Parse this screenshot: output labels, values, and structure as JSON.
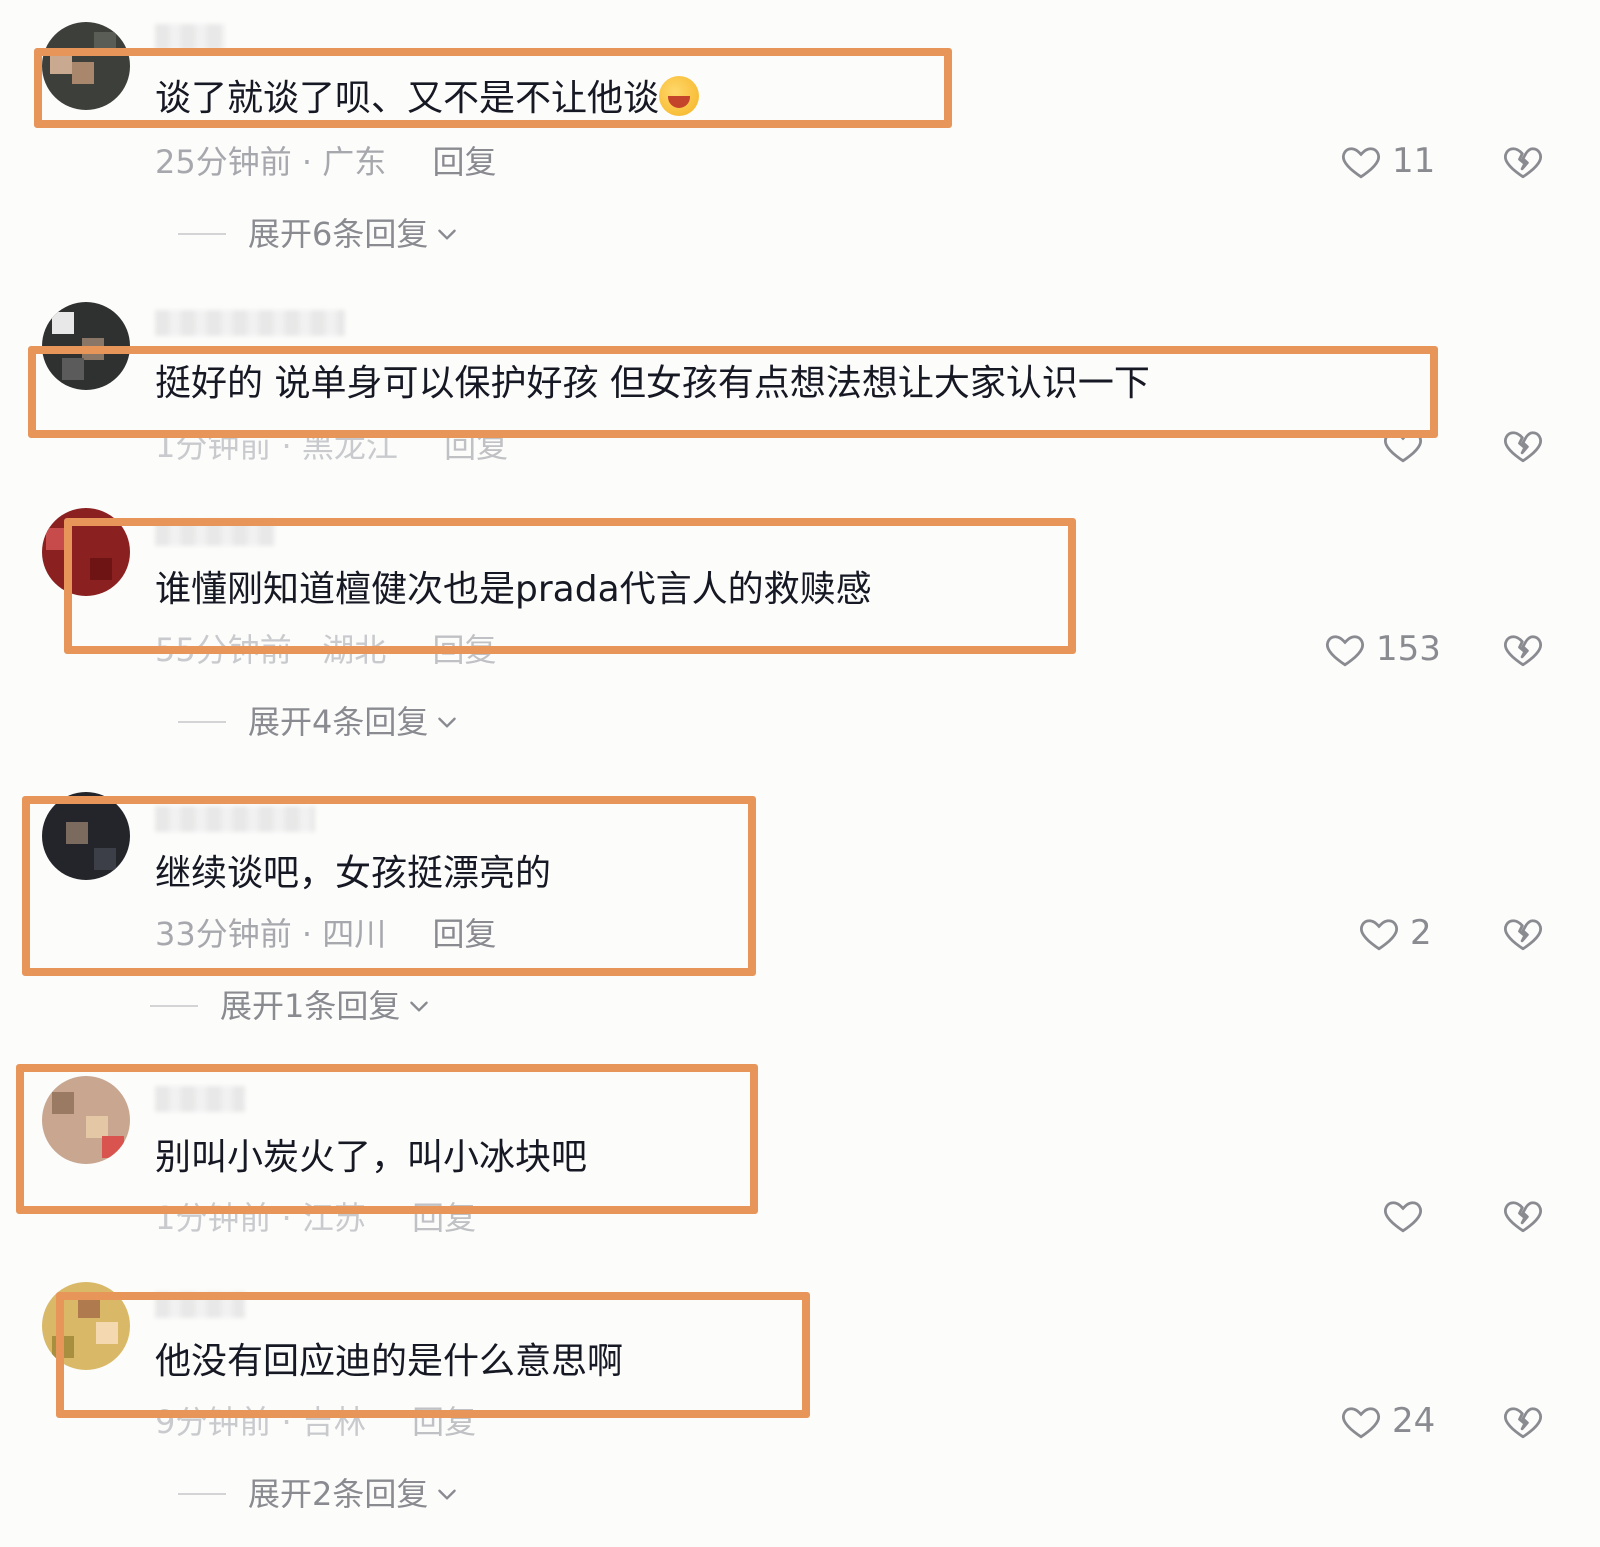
{
  "comments": [
    {
      "text": "谈了就谈了呗、又不是不让他谈",
      "time": "25分钟前",
      "region": "广东",
      "reply": "回复",
      "likes": "11",
      "expand": "展开6条回复",
      "has_emoji": true
    },
    {
      "text": "挺好的 说单身可以保护好孩 但女孩有点想法想让大家认识一下",
      "time": "1分钟前",
      "region": "黑龙江",
      "reply": "回复",
      "likes": ""
    },
    {
      "text": "谁懂刚知道檀健次也是prada代言人的救赎感",
      "time": "55分钟前",
      "region": "湖北",
      "reply": "回复",
      "likes": "153",
      "expand": "展开4条回复"
    },
    {
      "text": "继续谈吧，女孩挺漂亮的",
      "time": "33分钟前",
      "region": "四川",
      "reply": "回复",
      "likes": "2",
      "expand": "展开1条回复"
    },
    {
      "text": "别叫小炭火了，叫小冰块吧",
      "time": "1分钟前",
      "region": "江苏",
      "reply": "回复",
      "likes": ""
    },
    {
      "text": "他没有回应迪的是什么意思啊",
      "time": "9分钟前",
      "region": "吉林",
      "reply": "回复",
      "likes": "24",
      "expand": "展开2条回复"
    }
  ],
  "separator": "·",
  "highlight_color": "#e8955a"
}
